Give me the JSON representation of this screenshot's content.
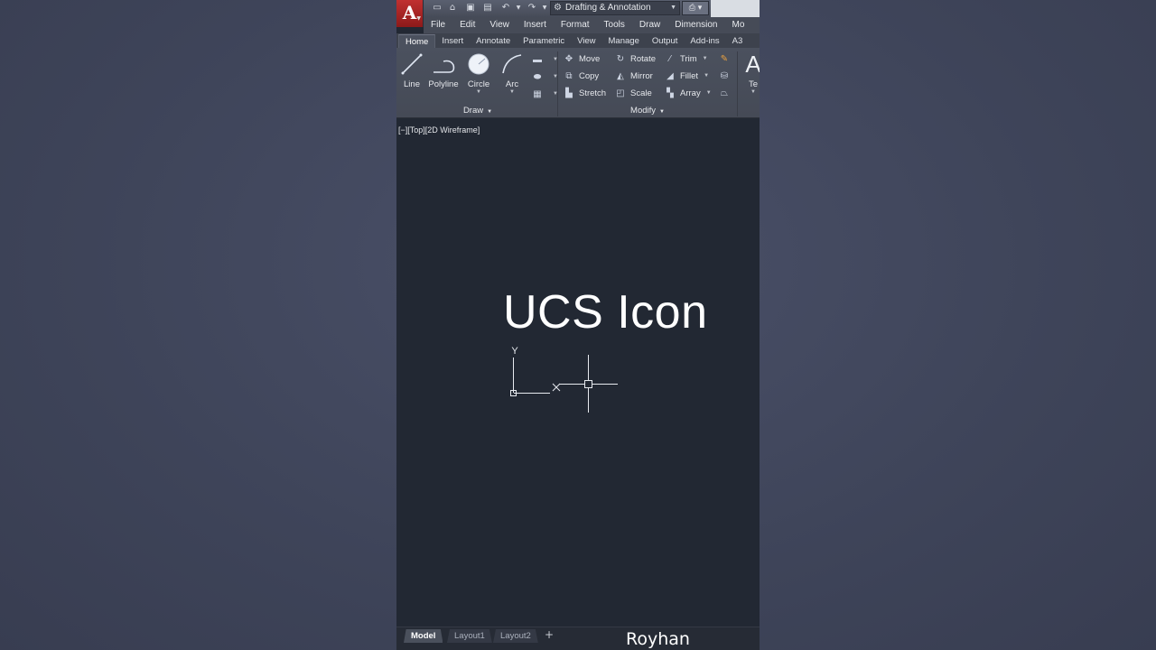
{
  "titlebar": {
    "app_logo": "A",
    "workspace": "Drafting & Annotation",
    "quick_access_icons": [
      "new-icon",
      "open-icon",
      "save-icon",
      "saveas-icon",
      "undo-icon",
      "redo-icon",
      "plot-icon"
    ]
  },
  "menubar": {
    "items": [
      "File",
      "Edit",
      "View",
      "Insert",
      "Format",
      "Tools",
      "Draw",
      "Dimension",
      "Mo"
    ]
  },
  "ribbon_tabs": {
    "items": [
      "Home",
      "Insert",
      "Annotate",
      "Parametric",
      "View",
      "Manage",
      "Output",
      "Add-ins",
      "A3"
    ],
    "active": "Home"
  },
  "ribbon": {
    "draw": {
      "title": "Draw",
      "tools": {
        "line": "Line",
        "polyline": "Polyline",
        "circle": "Circle",
        "arc": "Arc"
      }
    },
    "modify": {
      "title": "Modify",
      "tools": {
        "move": "Move",
        "rotate": "Rotate",
        "trim": "Trim",
        "copy": "Copy",
        "mirror": "Mirror",
        "fillet": "Fillet",
        "stretch": "Stretch",
        "scale": "Scale",
        "array": "Array"
      }
    },
    "annotation": {
      "text_partial": "Te"
    }
  },
  "viewport": {
    "label": "[−][Top][2D Wireframe]",
    "overlay_title": "UCS Icon",
    "ucs_axis_label": "Y"
  },
  "layout_tabs": [
    "Model",
    "Layout1",
    "Layout2"
  ],
  "layout_add": "+",
  "watermark": "Royhan",
  "colors": {
    "accent_red": "#b52525",
    "canvas": "#222833",
    "ribbon": "#4b515e"
  }
}
